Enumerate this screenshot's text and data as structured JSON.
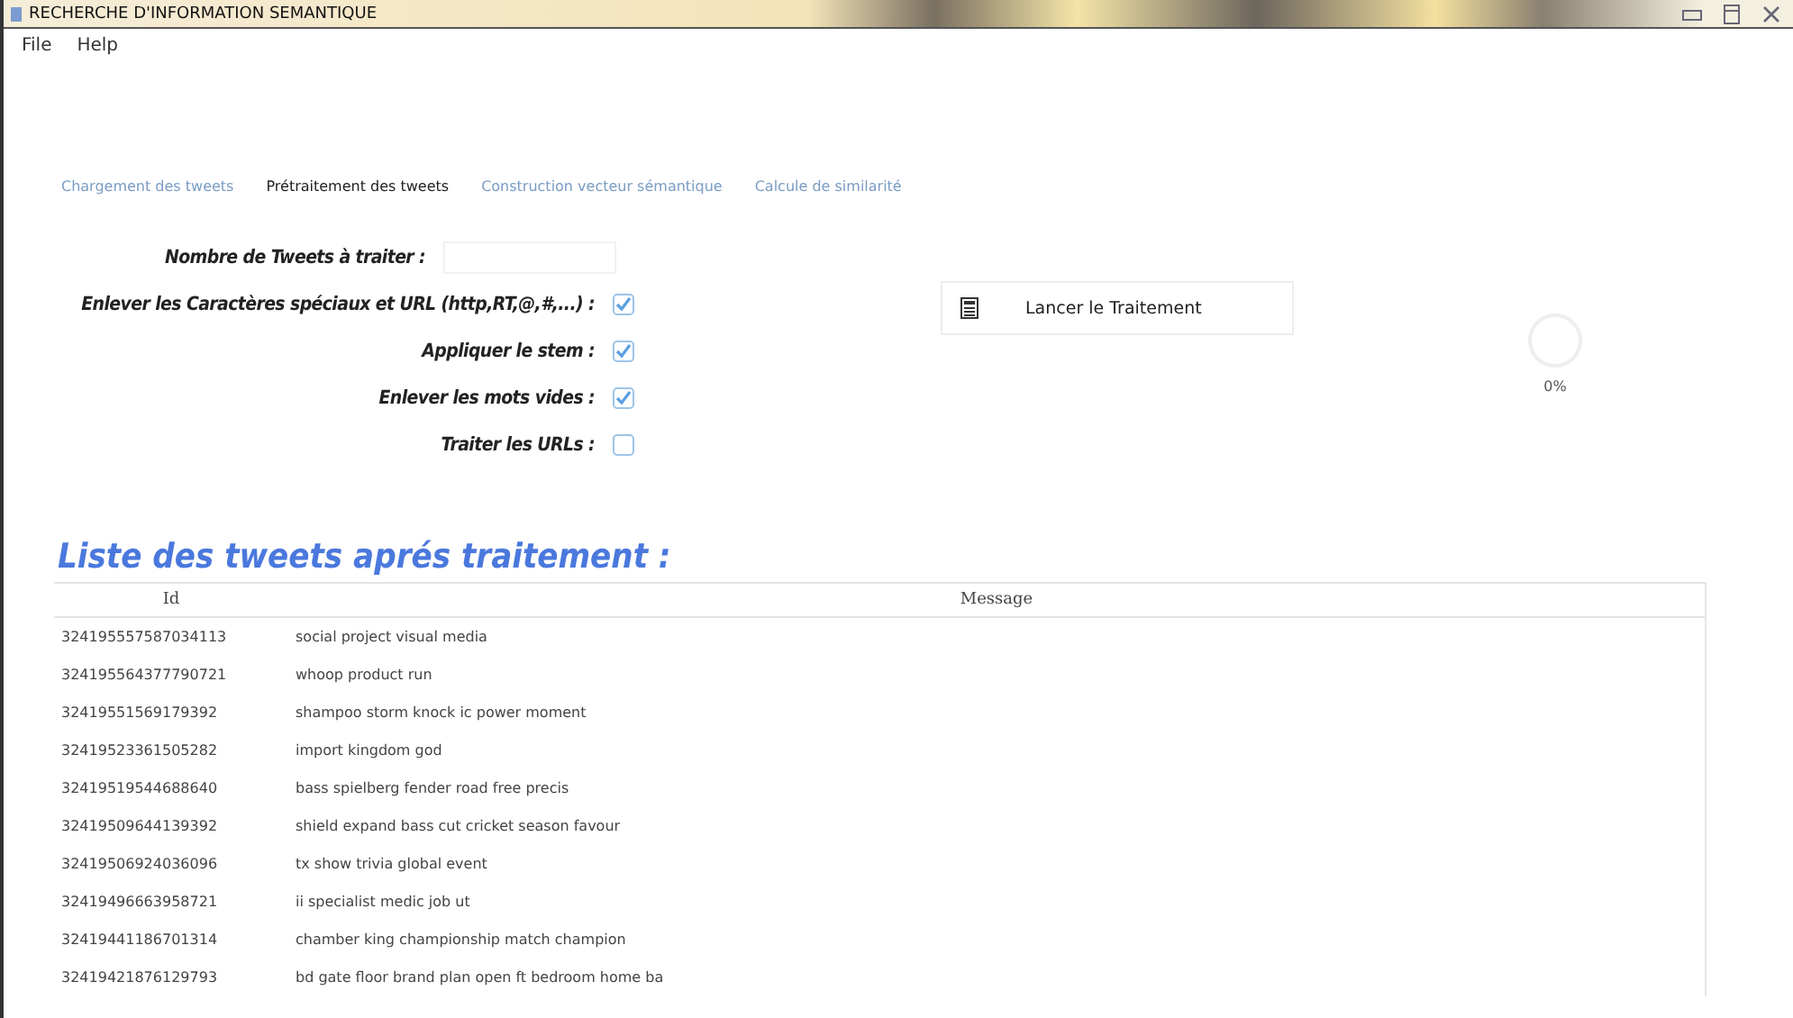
{
  "window": {
    "title": "RECHERCHE D'INFORMATION SEMANTIQUE"
  },
  "menu": [
    "File",
    "Help"
  ],
  "tabs": [
    {
      "label": "Chargement des tweets",
      "selected": false
    },
    {
      "label": "Prétraitement des tweets",
      "selected": true
    },
    {
      "label": "Construction vecteur sémantique",
      "selected": false
    },
    {
      "label": "Calcule de similarité",
      "selected": false
    }
  ],
  "form": {
    "count_field": {
      "label": "Nombre de Tweets à traiter :"
    },
    "options": [
      {
        "label": "Enlever les Caractères spéciaux et URL (http,RT,@,#,...) :",
        "checked": true
      },
      {
        "label": "Appliquer le stem :",
        "checked": true
      },
      {
        "label": "Enlever les mots vides :",
        "checked": true
      },
      {
        "label": "Traiter les URLs :",
        "checked": false
      }
    ]
  },
  "run_button": {
    "label": "Lancer le Traitement"
  },
  "progress": {
    "level": 0,
    "reading": "0%"
  },
  "results": {
    "title": "Liste des tweets aprés traitement :",
    "columns": [
      "Id",
      "Message"
    ],
    "rows": [
      [
        "324195557587034113",
        "social project visual media"
      ],
      [
        "324195564377790721",
        "whoop product run"
      ],
      [
        "32419551569179392",
        "shampoo storm knock ic power moment"
      ],
      [
        "32419523361505282",
        "import kingdom god"
      ],
      [
        "32419519544688640",
        "bass spielberg fender road free precis"
      ],
      [
        "32419509644139392",
        "shield expand bass cut cricket season favour"
      ],
      [
        "32419506924036096",
        "tx show trivia global event"
      ],
      [
        "32419496663958721",
        "ii specialist medic job ut"
      ],
      [
        "32419441186701314",
        "chamber king championship match champion"
      ],
      [
        "32419421876129793",
        "bd gate floor brand plan open ft bedroom home ba"
      ]
    ]
  }
}
